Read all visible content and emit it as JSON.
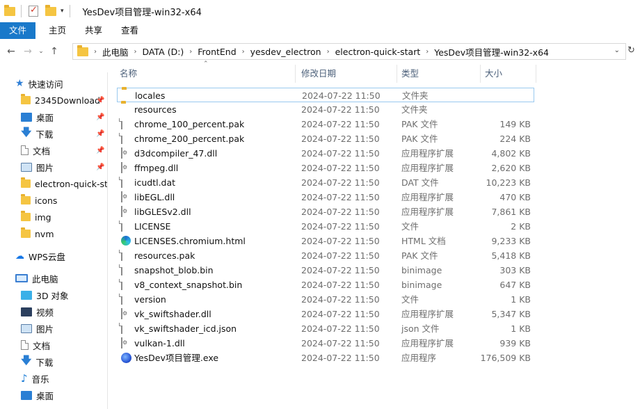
{
  "window": {
    "title": "YesDev项目管理-win32-x64"
  },
  "ribbon": {
    "tabs": [
      "文件",
      "主页",
      "共享",
      "查看"
    ]
  },
  "address": {
    "crumbs": [
      "此电脑",
      "DATA (D:)",
      "FrontEnd",
      "yesdev_electron",
      "electron-quick-start",
      "YesDev项目管理-win32-x64"
    ]
  },
  "sidebar": {
    "quick_access": "快速访问",
    "pinned": [
      {
        "label": "2345Download",
        "icon": "folder"
      },
      {
        "label": "桌面",
        "icon": "desktop"
      },
      {
        "label": "下载",
        "icon": "download"
      },
      {
        "label": "文档",
        "icon": "documents"
      },
      {
        "label": "图片",
        "icon": "pictures"
      }
    ],
    "folders": [
      "electron-quick-sta",
      "icons",
      "img",
      "nvm"
    ],
    "wps": "WPS云盘",
    "this_pc": "此电脑",
    "pc_items": [
      "3D 对象",
      "视频",
      "图片",
      "文档",
      "下载",
      "音乐",
      "桌面"
    ]
  },
  "columns": {
    "name": "名称",
    "date": "修改日期",
    "type": "类型",
    "size": "大小"
  },
  "files": [
    {
      "name": "locales",
      "date": "2024-07-22 11:50",
      "type": "文件夹",
      "size": "",
      "icon": "folder"
    },
    {
      "name": "resources",
      "date": "2024-07-22 11:50",
      "type": "文件夹",
      "size": "",
      "icon": "folder"
    },
    {
      "name": "chrome_100_percent.pak",
      "date": "2024-07-22 11:50",
      "type": "PAK 文件",
      "size": "149 KB",
      "icon": "file"
    },
    {
      "name": "chrome_200_percent.pak",
      "date": "2024-07-22 11:50",
      "type": "PAK 文件",
      "size": "224 KB",
      "icon": "file"
    },
    {
      "name": "d3dcompiler_47.dll",
      "date": "2024-07-22 11:50",
      "type": "应用程序扩展",
      "size": "4,802 KB",
      "icon": "dll"
    },
    {
      "name": "ffmpeg.dll",
      "date": "2024-07-22 11:50",
      "type": "应用程序扩展",
      "size": "2,620 KB",
      "icon": "dll"
    },
    {
      "name": "icudtl.dat",
      "date": "2024-07-22 11:50",
      "type": "DAT 文件",
      "size": "10,223 KB",
      "icon": "file"
    },
    {
      "name": "libEGL.dll",
      "date": "2024-07-22 11:50",
      "type": "应用程序扩展",
      "size": "470 KB",
      "icon": "dll"
    },
    {
      "name": "libGLESv2.dll",
      "date": "2024-07-22 11:50",
      "type": "应用程序扩展",
      "size": "7,861 KB",
      "icon": "dll"
    },
    {
      "name": "LICENSE",
      "date": "2024-07-22 11:50",
      "type": "文件",
      "size": "2 KB",
      "icon": "file"
    },
    {
      "name": "LICENSES.chromium.html",
      "date": "2024-07-22 11:50",
      "type": "HTML 文档",
      "size": "9,233 KB",
      "icon": "edge"
    },
    {
      "name": "resources.pak",
      "date": "2024-07-22 11:50",
      "type": "PAK 文件",
      "size": "5,418 KB",
      "icon": "file"
    },
    {
      "name": "snapshot_blob.bin",
      "date": "2024-07-22 11:50",
      "type": "binimage",
      "size": "303 KB",
      "icon": "file"
    },
    {
      "name": "v8_context_snapshot.bin",
      "date": "2024-07-22 11:50",
      "type": "binimage",
      "size": "647 KB",
      "icon": "file"
    },
    {
      "name": "version",
      "date": "2024-07-22 11:50",
      "type": "文件",
      "size": "1 KB",
      "icon": "file"
    },
    {
      "name": "vk_swiftshader.dll",
      "date": "2024-07-22 11:50",
      "type": "应用程序扩展",
      "size": "5,347 KB",
      "icon": "dll"
    },
    {
      "name": "vk_swiftshader_icd.json",
      "date": "2024-07-22 11:50",
      "type": "json 文件",
      "size": "1 KB",
      "icon": "file"
    },
    {
      "name": "vulkan-1.dll",
      "date": "2024-07-22 11:50",
      "type": "应用程序扩展",
      "size": "939 KB",
      "icon": "dll"
    },
    {
      "name": "YesDev项目管理.exe",
      "date": "2024-07-22 11:50",
      "type": "应用程序",
      "size": "176,509 KB",
      "icon": "exe"
    }
  ]
}
